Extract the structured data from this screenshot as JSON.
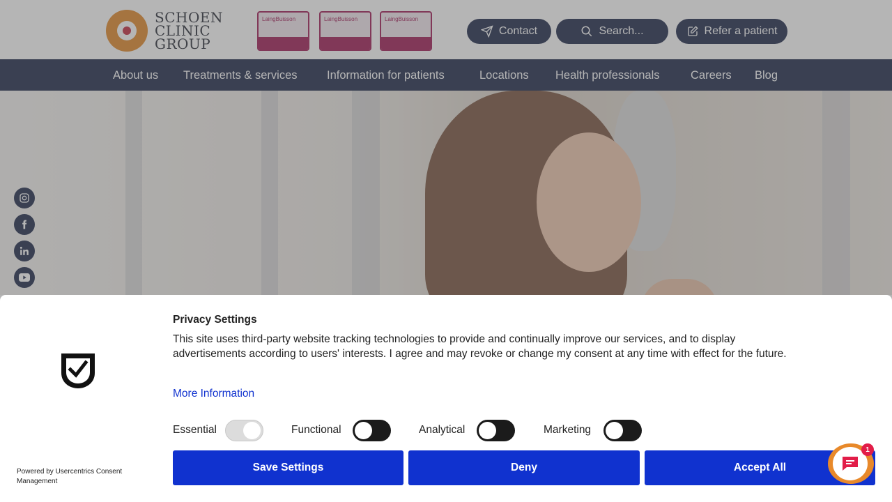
{
  "header": {
    "logo_lines": [
      "SCHOEN",
      "CLINIC",
      "GROUP"
    ],
    "awards": [
      {
        "brand": "LaingBuisson"
      },
      {
        "brand": "LaingBuisson"
      },
      {
        "brand": "LaingBuisson"
      }
    ],
    "contact_label": "Contact",
    "search_label": "Search...",
    "refer_label": "Refer a patient"
  },
  "nav": {
    "items": [
      {
        "label": "About us"
      },
      {
        "label": "Treatments & services"
      },
      {
        "label": "Information for patients"
      },
      {
        "label": "Locations"
      },
      {
        "label": "Health professionals"
      },
      {
        "label": "Careers"
      },
      {
        "label": "Blog"
      }
    ]
  },
  "social": {
    "icons": [
      "instagram-icon",
      "facebook-icon",
      "linkedin-icon",
      "youtube-icon"
    ]
  },
  "consent": {
    "title": "Privacy Settings",
    "description": "This site uses third-party website tracking technologies to provide and continually improve our services, and to display advertisements according to users' interests. I agree and may revoke or change my consent at any time with effect for the future.",
    "more_info": "More Information",
    "powered_by": "Powered by Usercentrics Consent Management",
    "categories": [
      {
        "label": "Essential",
        "enabled": true
      },
      {
        "label": "Functional",
        "enabled": false
      },
      {
        "label": "Analytical",
        "enabled": false
      },
      {
        "label": "Marketing",
        "enabled": false
      }
    ],
    "buttons": {
      "save": "Save Settings",
      "deny": "Deny",
      "accept": "Accept All"
    }
  },
  "chat": {
    "badge_count": "1"
  },
  "colors": {
    "navy": "#1f2a4c",
    "accent_blue": "#1032cf",
    "brand_orange": "#e2892a",
    "award_magenta": "#a01c57",
    "badge_red": "#e21d48"
  }
}
